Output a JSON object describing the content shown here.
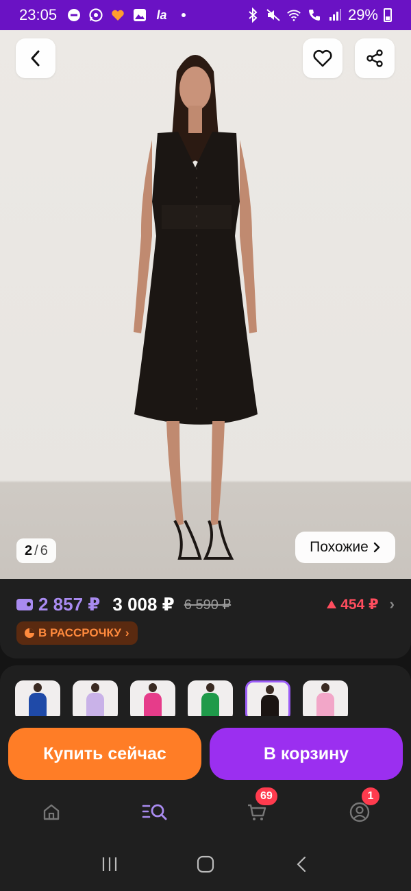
{
  "status_bar": {
    "time": "23:05",
    "left_icons": [
      "dnd-icon",
      "whatsapp-icon",
      "hearts-icon",
      "gallery-icon",
      "la-icon",
      "dot-icon"
    ],
    "la_text": "la",
    "right_icons": [
      "bluetooth-icon",
      "mute-icon",
      "wifi-icon",
      "wifi-call-icon",
      "signal-icon",
      "battery-icon"
    ],
    "battery": "29%"
  },
  "gallery": {
    "current": "2",
    "separator": "/",
    "total": "6",
    "similar_label": "Похожие"
  },
  "price": {
    "main": "2 857 ₽",
    "regular": "3 008 ₽",
    "old": "6 590 ₽",
    "diff": "454 ₽",
    "installment": "В РАССРОЧКУ"
  },
  "variants": [
    {
      "color": "#1f4aa8"
    },
    {
      "color": "#c9b2e8"
    },
    {
      "color": "#e63c8a"
    },
    {
      "color": "#1f9a4a"
    },
    {
      "color": "#1a1412",
      "active": true
    },
    {
      "color": "#f2a6c8"
    }
  ],
  "actions": {
    "buy_now": "Купить сейчас",
    "add_to_cart": "В корзину"
  },
  "navbar": {
    "cart_badge": "69",
    "profile_badge": "1",
    "active_color": "#a98bf0"
  }
}
